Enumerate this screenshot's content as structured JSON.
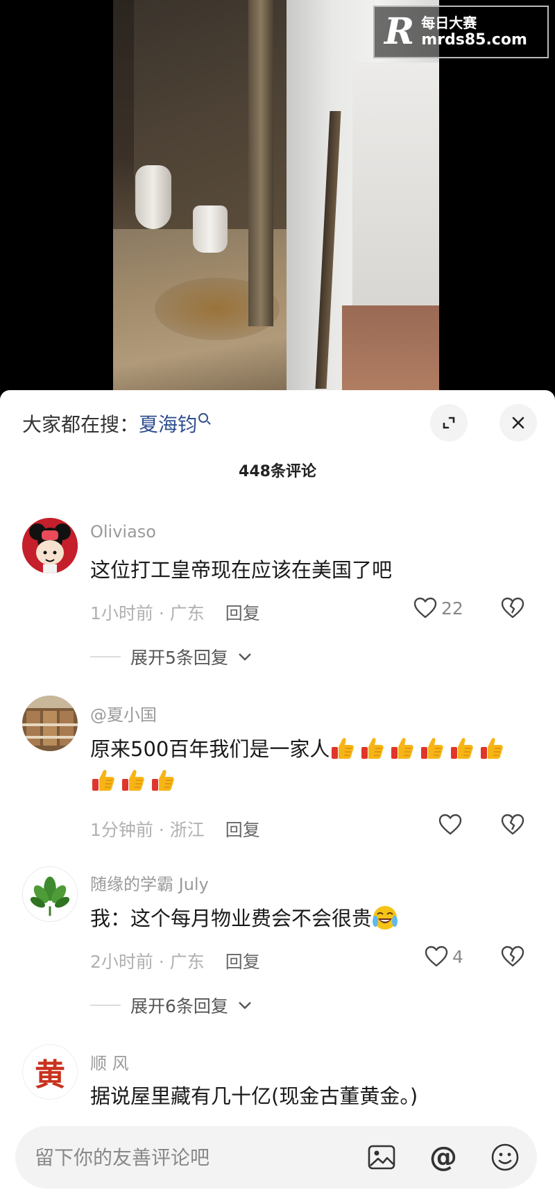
{
  "watermark": {
    "logo": "R",
    "site_name_cn": "每日大赛",
    "site_url": "mrds85.com"
  },
  "search": {
    "prefix": "大家都在搜：",
    "keyword": "夏海钧"
  },
  "comments_header": {
    "count_label": "448条评论"
  },
  "comments": [
    {
      "username": "Oliviaso",
      "text": "这位打工皇帝现在应该在美国了吧",
      "time": "1小时前",
      "location": "广东",
      "reply_label": "回复",
      "likes": "22",
      "expand_replies": "展开5条回复"
    },
    {
      "username": "@夏小国",
      "text": "原来500百年我们是一家人",
      "emoji_count": 9,
      "time": "1分钟前",
      "location": "浙江",
      "reply_label": "回复",
      "likes": ""
    },
    {
      "username": "随缘的学霸 July",
      "text": "我：这个每月物业费会不会很贵",
      "time": "2小时前",
      "location": "广东",
      "reply_label": "回复",
      "likes": "4",
      "expand_replies": "展开6条回复"
    },
    {
      "username": "顺 风",
      "avatar_char": "黄",
      "text": "据说屋里藏有几十亿(现金古董黄金。)"
    }
  ],
  "input": {
    "placeholder": "留下你的友善评论吧"
  },
  "icons": [
    "search-icon",
    "expand-icon",
    "close-icon",
    "heart-icon",
    "broken-heart-icon",
    "chevron-down-icon",
    "image-icon",
    "at-icon",
    "emoji-icon"
  ],
  "colors": {
    "link": "#2f4e8f",
    "muted": "#9a9a9a",
    "background": "#ffffff"
  }
}
